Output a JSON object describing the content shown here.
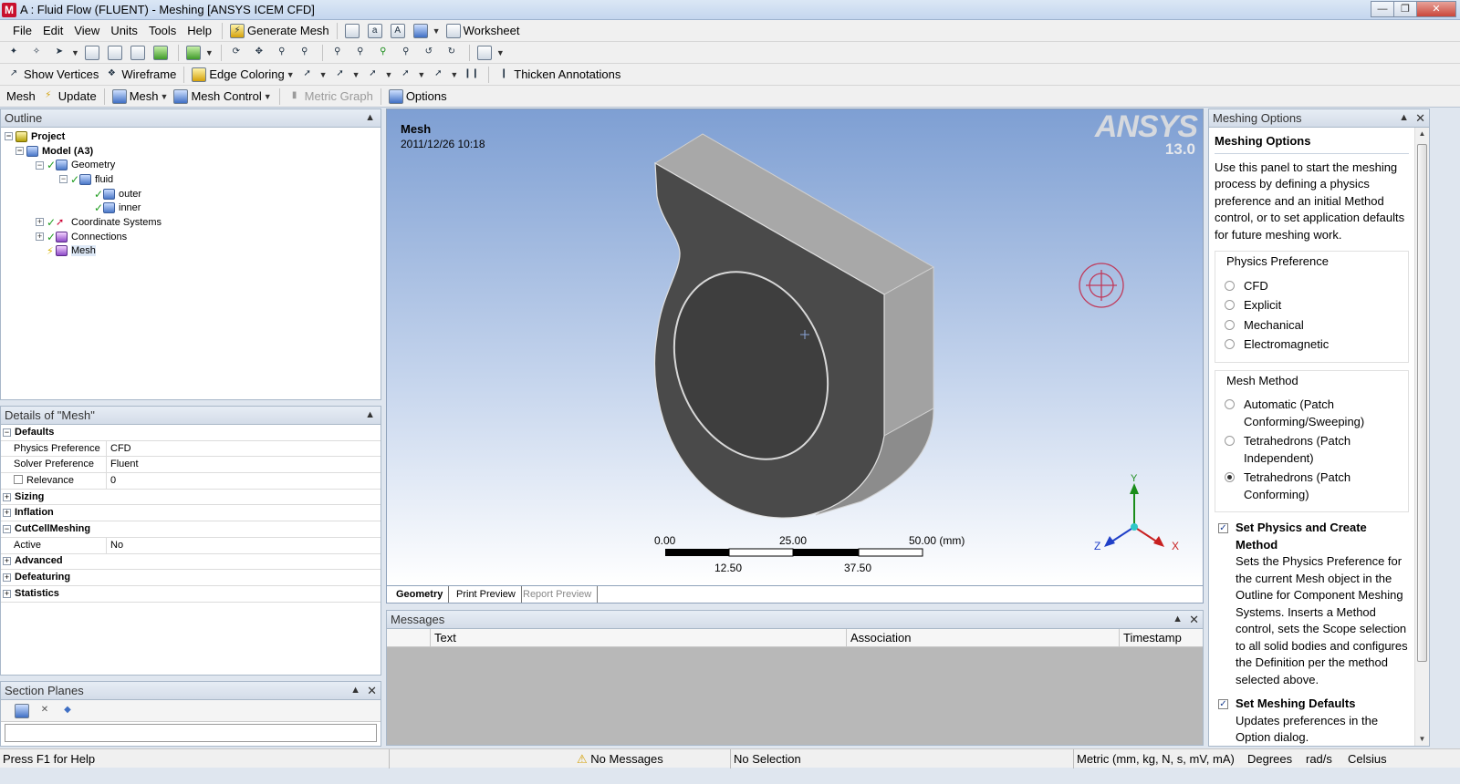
{
  "window": {
    "title": "A : Fluid Flow (FLUENT) - Meshing [ANSYS ICEM CFD]",
    "app_icon": "M"
  },
  "menu": [
    "File",
    "Edit",
    "View",
    "Units",
    "Tools",
    "Help"
  ],
  "toolbar1": {
    "generate_mesh": "Generate Mesh",
    "worksheet": "Worksheet"
  },
  "toolbar2": {
    "show_vertices": "Show Vertices",
    "wireframe": "Wireframe",
    "edge_coloring": "Edge Coloring",
    "thicken_annotations": "Thicken Annotations"
  },
  "toolbar3": {
    "mesh_label": "Mesh",
    "update": "Update",
    "mesh": "Mesh",
    "mesh_control": "Mesh Control",
    "metric_graph": "Metric Graph",
    "options": "Options"
  },
  "outline": {
    "title": "Outline",
    "items": {
      "project": "Project",
      "model": "Model (A3)",
      "geometry": "Geometry",
      "fluid": "fluid",
      "outer": "outer",
      "inner": "inner",
      "coordinate_systems": "Coordinate Systems",
      "connections": "Connections",
      "mesh": "Mesh"
    }
  },
  "details": {
    "title": "Details of \"Mesh\"",
    "groups": {
      "defaults": "Defaults",
      "sizing": "Sizing",
      "inflation": "Inflation",
      "cutcell": "CutCellMeshing",
      "advanced": "Advanced",
      "defeaturing": "Defeaturing",
      "statistics": "Statistics"
    },
    "rows": {
      "physics_pref_label": "Physics Preference",
      "physics_pref_value": "CFD",
      "solver_pref_label": "Solver Preference",
      "solver_pref_value": "Fluent",
      "relevance_label": "Relevance",
      "relevance_value": "0",
      "active_label": "Active",
      "active_value": "No"
    }
  },
  "section_planes": {
    "title": "Section Planes"
  },
  "viewport": {
    "label": "Mesh",
    "timestamp": "2011/12/26 10:18",
    "logo": "ANSYS",
    "version": "13.0",
    "scale": {
      "t0": "0.00",
      "t25": "25.00",
      "t50": "50.00 (mm)",
      "t12": "12.50",
      "t37": "37.50"
    },
    "axes": {
      "x": "X",
      "y": "Y",
      "z": "Z"
    }
  },
  "view_tabs": [
    "Geometry",
    "Print Preview",
    "Report Preview"
  ],
  "messages": {
    "title": "Messages",
    "columns": [
      "Text",
      "Association",
      "Timestamp"
    ]
  },
  "meshing_options": {
    "title": "Meshing Options",
    "heading": "Meshing Options",
    "intro": "Use this panel to start the meshing process by defining a physics preference and an initial Method control, or to set application defaults for future meshing work.",
    "physics_pref_title": "Physics Preference",
    "physics": [
      "CFD",
      "Explicit",
      "Mechanical",
      "Electromagnetic"
    ],
    "mesh_method_title": "Mesh Method",
    "methods": [
      "Automatic (Patch Conforming/Sweeping)",
      "Tetrahedrons (Patch Independent)",
      "Tetrahedrons (Patch Conforming)"
    ],
    "check1_title": "Set Physics and Create Method",
    "check1_text": "Sets the Physics Preference for the current Mesh object in the Outline for Component Meshing Systems. Inserts a Method control, sets the Scope selection to all solid bodies and configures the Definition per the method selected above.",
    "check2_title": "Set Meshing Defaults",
    "check2_text": "Updates preferences in the Option dialog."
  },
  "status": {
    "help": "Press F1 for Help",
    "messages": "No Messages",
    "selection": "No Selection",
    "units": "Metric (mm, kg, N, s, mV, mA)",
    "angle": "Degrees",
    "rate": "rad/s",
    "temp": "Celsius"
  },
  "colors": {
    "accent_red": "#c8102e",
    "viewport_top": "#7e9fd3",
    "model_face": "#4a4a4a"
  }
}
